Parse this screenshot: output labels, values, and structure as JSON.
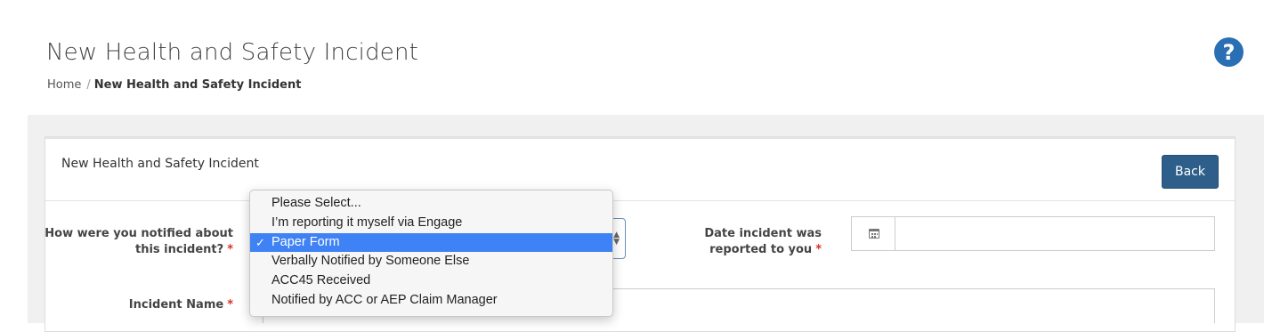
{
  "header": {
    "title": "New Health and Safety Incident",
    "help_icon": "question-circle-icon",
    "help_symbol": "?",
    "help_color": "#2a6fb3"
  },
  "breadcrumb": {
    "home": "Home",
    "separator": "/",
    "current": "New Health and Safety Incident"
  },
  "panel": {
    "title": "New Health and Safety Incident",
    "back_label": "Back",
    "back_color": "#2e5f8a"
  },
  "form": {
    "notified_label": "How were you notified about this incident?",
    "date_label": "Date incident was reported to you",
    "name_label": "Incident Name",
    "required_marker": "*",
    "date_value": "",
    "name_value": "",
    "calendar_icon": "calendar-icon"
  },
  "dropdown": {
    "selected_index": 2,
    "check_mark": "✓",
    "options": [
      "Please Select...",
      "I’m reporting it myself via Engage",
      "Paper Form",
      "Verbally Notified by Someone Else",
      "ACC45 Received",
      "Notified by ACC or AEP Claim Manager"
    ],
    "highlight_color": "#3f82f6"
  }
}
